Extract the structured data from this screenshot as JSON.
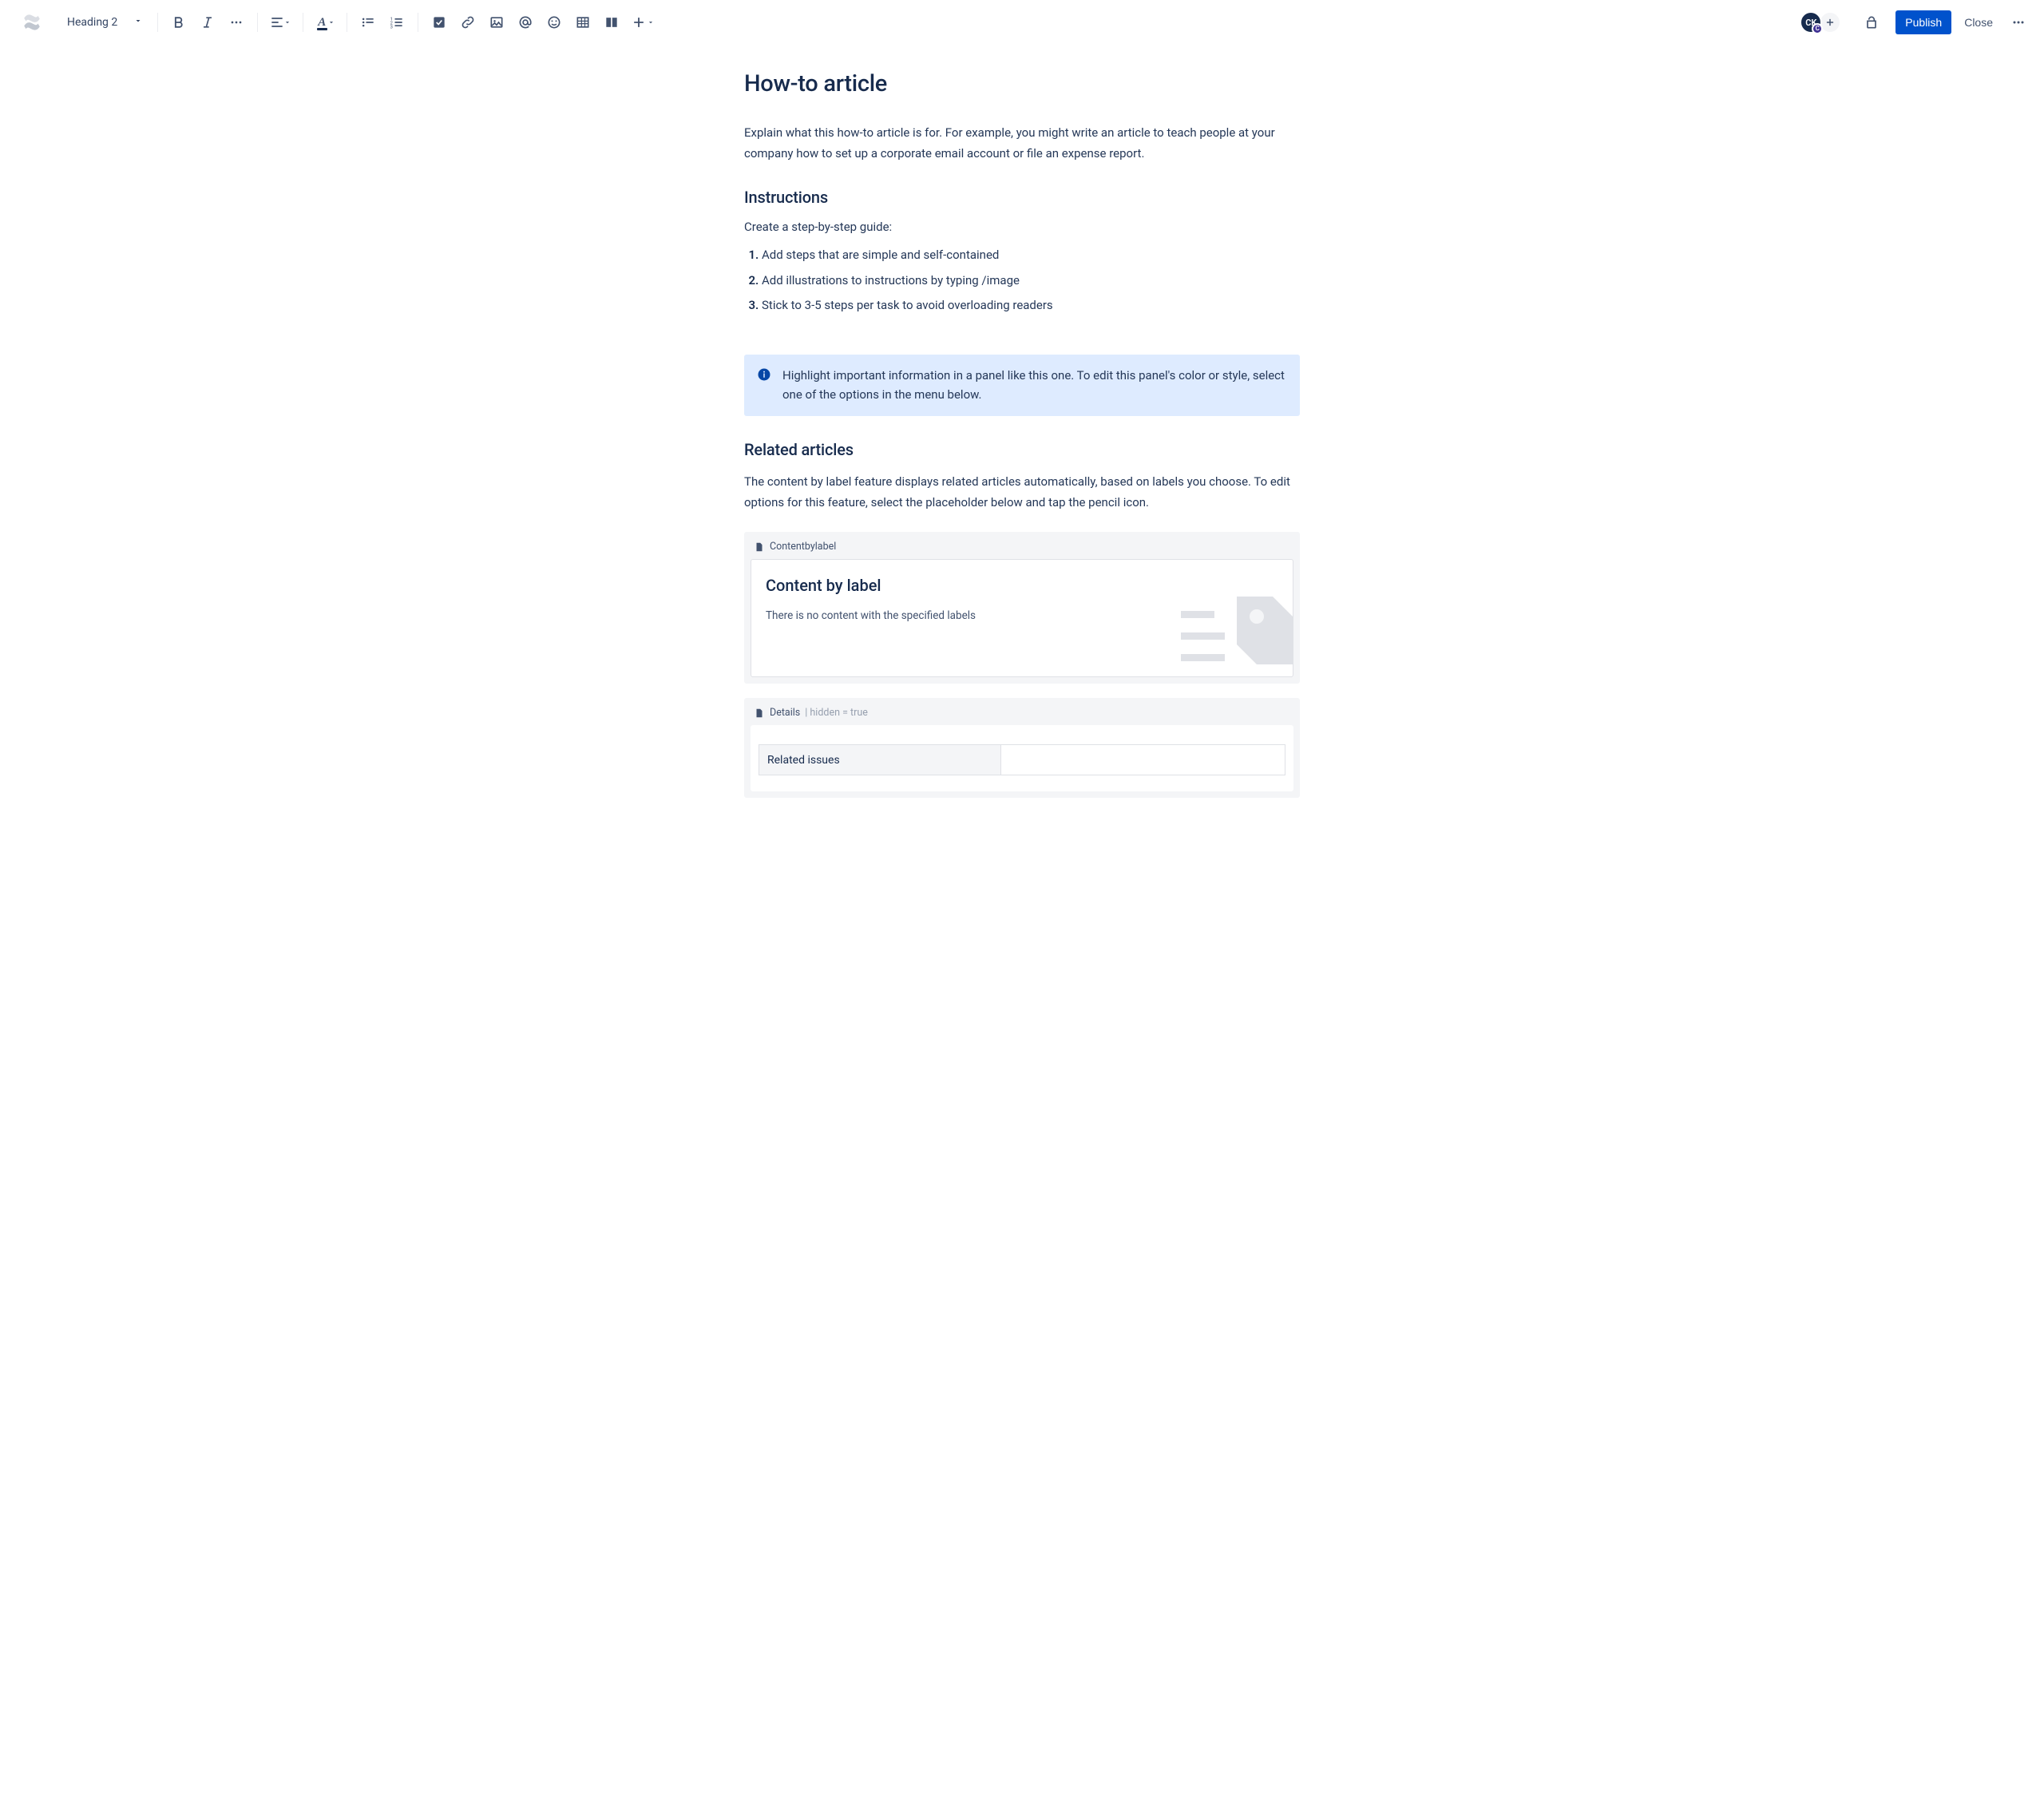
{
  "toolbar": {
    "text_style": "Heading 2",
    "publish": "Publish",
    "close": "Close",
    "avatar_initials": "CK",
    "avatar_badge": "C"
  },
  "page": {
    "title": "How-to article",
    "intro": "Explain what this how-to article is for. For example, you might write an article to teach people at your company how to set up a corporate email account or file an expense report.",
    "instructions_heading": "Instructions",
    "instructions_intro": "Create a step-by-step guide:",
    "steps": [
      "Add steps that are simple and self-contained",
      "Add illustrations to instructions by typing /image",
      "Stick to 3-5 steps per task to avoid overloading readers"
    ],
    "info_panel": "Highlight important information in a panel like this one. To edit this panel's color or style, select one of the options in the menu below.",
    "related_heading": "Related articles",
    "related_text": "The content by label feature displays related articles automatically, based on labels you choose. To edit options for this feature, select the placeholder below and tap the pencil icon."
  },
  "macros": {
    "content_by_label_name": "Contentbylabel",
    "content_by_label_title": "Content by label",
    "content_by_label_empty": "There is no content with the specified labels",
    "details_name": "Details",
    "details_params": " | hidden = true",
    "details_row_label": "Related issues"
  }
}
